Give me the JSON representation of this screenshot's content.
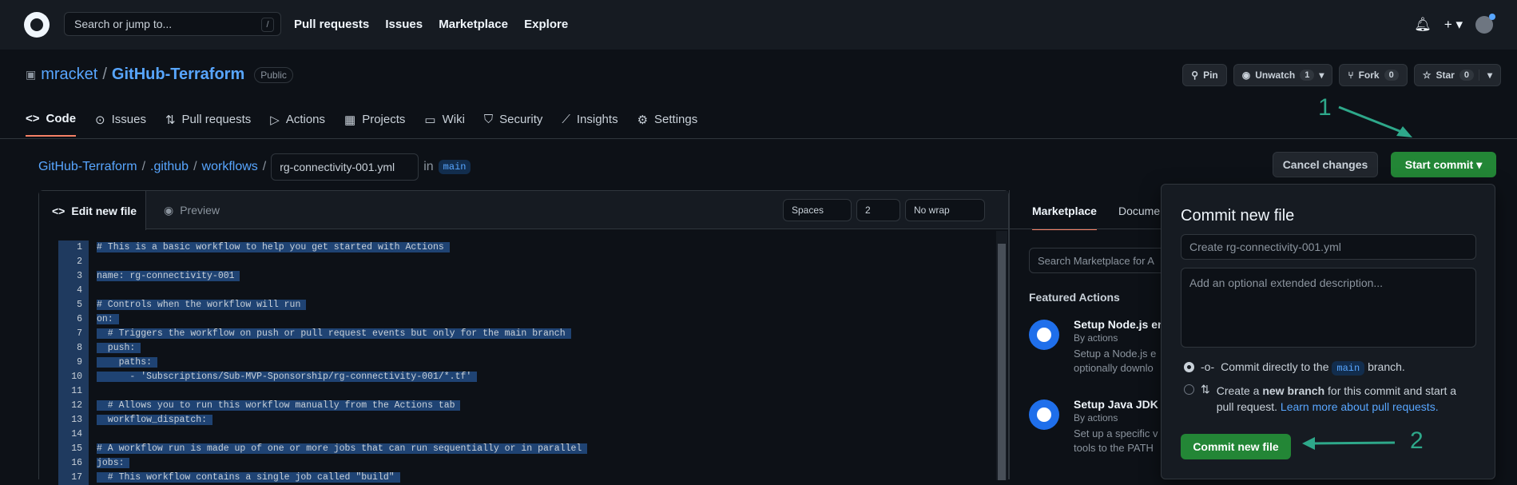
{
  "header": {
    "search_placeholder": "Search or jump to...",
    "search_shortcut": "/",
    "nav": [
      "Pull requests",
      "Issues",
      "Marketplace",
      "Explore"
    ],
    "icons": [
      "bell-icon",
      "plus-icon",
      "avatar"
    ]
  },
  "repo": {
    "owner": "mracket",
    "name": "GitHub-Terraform",
    "visibility": "Public",
    "buttons": {
      "pin": "Pin",
      "unwatch": "Unwatch",
      "unwatch_count": "1",
      "fork": "Fork",
      "fork_count": "0",
      "star": "Star",
      "star_count": "0"
    },
    "tabs": [
      "Code",
      "Issues",
      "Pull requests",
      "Actions",
      "Projects",
      "Wiki",
      "Security",
      "Insights",
      "Settings"
    ]
  },
  "breadcrumb": {
    "repo": "GitHub-Terraform",
    "dir1": ".github",
    "dir2": "workflows",
    "filename": "rg-connectivity-001.yml",
    "in": "in",
    "branch": "main"
  },
  "actions": {
    "cancel": "Cancel changes",
    "start_commit": "Start commit"
  },
  "editor": {
    "tab_edit": "Edit new file",
    "tab_preview": "Preview",
    "indent_mode": "Spaces",
    "indent_size": "2",
    "wrap_mode": "No wrap",
    "lines": [
      "# This is a basic workflow to help you get started with Actions",
      "",
      "name: rg-connectivity-001",
      "",
      "# Controls when the workflow will run",
      "on:",
      "  # Triggers the workflow on push or pull request events but only for the main branch",
      "  push:",
      "    paths:",
      "      - 'Subscriptions/Sub-MVP-Sponsorship/rg-connectivity-001/*.tf'",
      "",
      "  # Allows you to run this workflow manually from the Actions tab",
      "  workflow_dispatch:",
      "",
      "# A workflow run is made up of one or more jobs that can run sequentially or in parallel",
      "jobs:",
      "  # This workflow contains a single job called \"build\""
    ]
  },
  "sidebar": {
    "tab_marketplace": "Marketplace",
    "tab_docs": "Documen",
    "search_placeholder": "Search Marketplace for A",
    "featured": "Featured Actions",
    "items": [
      {
        "title": "Setup Node.js en",
        "by": "By actions",
        "desc1": "Setup a Node.js e",
        "desc2": "optionally downlo"
      },
      {
        "title": "Setup Java JDK",
        "by": "By actions",
        "desc1": "Set up a specific v",
        "desc2": "tools to the PATH"
      }
    ]
  },
  "commit_panel": {
    "title": "Commit new file",
    "summary_placeholder": "Create rg-connectivity-001.yml",
    "desc_placeholder": "Add an optional extended description...",
    "option1_pre": "Commit directly to the",
    "option1_branch": "main",
    "option1_post": "branch.",
    "option2_pre": "Create a",
    "option2_bold": "new branch",
    "option2_post": "for this commit and start a",
    "option2_line2": "pull request.",
    "option2_link": "Learn more about pull requests.",
    "submit": "Commit new file"
  },
  "annotations": {
    "one": "1",
    "two": "2"
  }
}
